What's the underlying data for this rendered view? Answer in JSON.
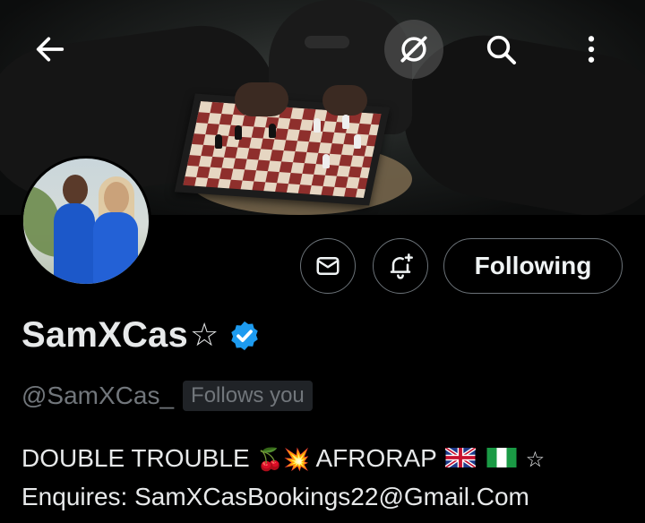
{
  "topbar": {
    "back_icon": "arrow-left-icon",
    "grok_icon": "grok-slash-icon",
    "search_icon": "search-icon",
    "more_icon": "more-vertical-icon"
  },
  "profile": {
    "display_name": "SamXCas",
    "name_suffix": "☆",
    "verified": true,
    "handle": "@SamXCas_",
    "follows_you": "Follows you",
    "bio_line1_prefix": "DOUBLE TROUBLE",
    "bio_line1_emoji": "🍒💥",
    "bio_line1_mid": "AFRORAP",
    "bio_line1_suffix": "☆",
    "bio_line2": "Enquires: SamXCasBookings22@Gmail.Com"
  },
  "actions": {
    "message_icon": "mail-icon",
    "notify_icon": "bell-plus-icon",
    "follow_label": "Following"
  },
  "colors": {
    "background": "#000000",
    "text_primary": "#e7e9ea",
    "text_secondary": "#71767b",
    "verified_blue": "#1d9bf0",
    "button_border": "#6b7278",
    "badge_bg": "#202327"
  }
}
